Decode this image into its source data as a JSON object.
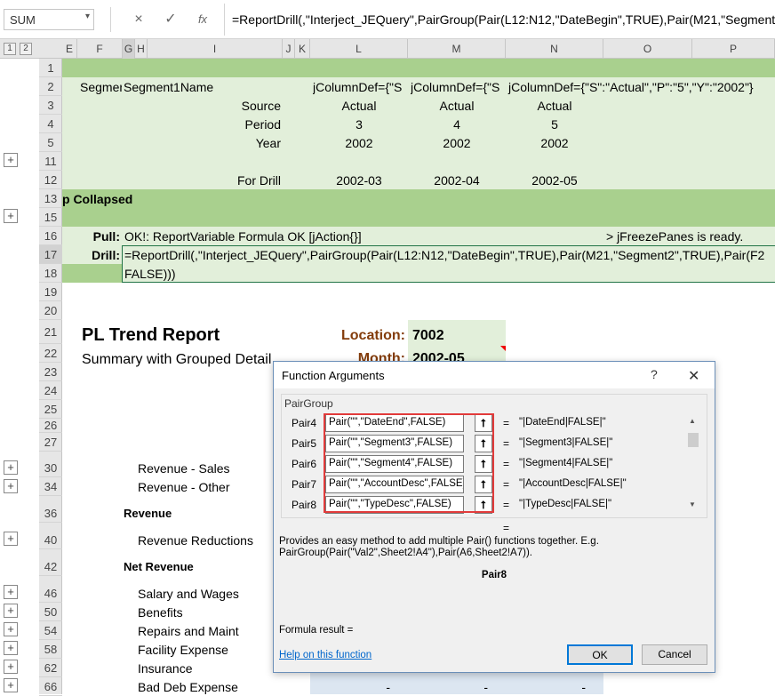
{
  "formula_bar": {
    "name_box": "SUM",
    "cancel_icon": "×",
    "enter_icon": "✓",
    "fx_icon": "fx",
    "formula": "=ReportDrill(,\"Interject_JEQuery\",PairGroup(Pair(L12:N12,\"DateBegin\",TRUE),Pair(M21,\"Segment2"
  },
  "outline_levels": [
    "1",
    "2"
  ],
  "columns": [
    "E",
    "F",
    "G",
    "H",
    "I",
    "J",
    "K",
    "L",
    "M",
    "N",
    "O",
    "P"
  ],
  "rows": [
    "1",
    "2",
    "3",
    "4",
    "5",
    "11",
    "12",
    "13",
    "15",
    "16",
    "17",
    "18",
    "19",
    "20",
    "21",
    "22",
    "23",
    "24",
    "25",
    "26",
    "27",
    "30",
    "34",
    "36",
    "40",
    "42",
    "46",
    "50",
    "54",
    "58",
    "62",
    "66"
  ],
  "cells": {
    "r2_f": "Segmer",
    "r2_g": "Segment1Name",
    "r2_l": "jColumnDef={\"S",
    "r2_m": "jColumnDef={\"S",
    "r2_n": "jColumnDef={\"S\":\"Actual\",\"P\":\"5\",\"Y\":\"2002\"}",
    "r3_i": "Source",
    "r3_l": "Actual",
    "r3_m": "Actual",
    "r3_n": "Actual",
    "r4_i": "Period",
    "r4_l": "3",
    "r4_m": "4",
    "r4_n": "5",
    "r5_i": "Year",
    "r5_l": "2002",
    "r5_m": "2002",
    "r5_n": "2002",
    "r12_i": "For Drill",
    "r12_l": "2002-03",
    "r12_m": "2002-04",
    "r12_n": "2002-05",
    "r13_e": "p Collapsed",
    "r16_f": "Pull:",
    "r16_g": "OK!: ReportVariable Formula OK [jAction{}]",
    "r16_o": "> jFreezePanes is ready.",
    "r17_f": "Drill:",
    "r17_g": "=ReportDrill(,\"Interject_JEQuery\",PairGroup(Pair(L12:N12,\"DateBegin\",TRUE),Pair(M21,\"Segment2\",TRUE),Pair(F2",
    "r18_g": "FALSE)))",
    "r21_f": "PL Trend Report",
    "r21_k": "Location:",
    "r21_l": "7002",
    "r22_f": "Summary with Grouped Detail",
    "r22_k": "Month:",
    "r22_l": "2002-05",
    "r30_g": "Revenue - Sales",
    "r34_g": "Revenue - Other",
    "r36_g": "Revenue",
    "r40_g": "Revenue Reductions",
    "r42_g": "Net Revenue",
    "r46_g": "Salary and Wages",
    "r50_g": "Benefits",
    "r54_g": "Repairs and Maint",
    "r58_g": "Facility Expense",
    "r62_g": "Insurance",
    "r66_g": "Bad Deb Expense",
    "r66_l": "-",
    "r66_m": "-",
    "r66_n": "-"
  },
  "dialog": {
    "title": "Function Arguments",
    "help_icon": "?",
    "close_icon": "✕",
    "function_name": "PairGroup",
    "args": [
      {
        "label": "Pair4",
        "value": "Pair(\"\",\"DateEnd\",FALSE)",
        "result": "\"|DateEnd|FALSE|\""
      },
      {
        "label": "Pair5",
        "value": "Pair(\"\",\"Segment3\",FALSE)",
        "result": "\"|Segment3|FALSE|\""
      },
      {
        "label": "Pair6",
        "value": "Pair(\"\",\"Segment4\",FALSE)",
        "result": "\"|Segment4|FALSE|\""
      },
      {
        "label": "Pair7",
        "value": "Pair(\"\",\"AccountDesc\",FALSE)",
        "result": "\"|AccountDesc|FALSE|\""
      },
      {
        "label": "Pair8",
        "value": "Pair(\"\",\"TypeDesc\",FALSE)",
        "result": "\"|TypeDesc|FALSE|\""
      }
    ],
    "eq": "=",
    "collapse_icon": "⭡",
    "description": "Provides an easy method to add multiple Pair() functions together.  E.g. PairGroup(Pair(\"Val2\",Sheet2!A4\"),Pair(A6,Sheet2!A7)).",
    "current_arg": "Pair8",
    "result_label": "Formula result =",
    "help_link": "Help on this function",
    "ok": "OK",
    "cancel": "Cancel"
  },
  "colors": {
    "band_green": "#e2efda",
    "dark_green": "#a9d08e",
    "brown_label": "#833c0b",
    "blue_cell": "#dce6f1"
  }
}
